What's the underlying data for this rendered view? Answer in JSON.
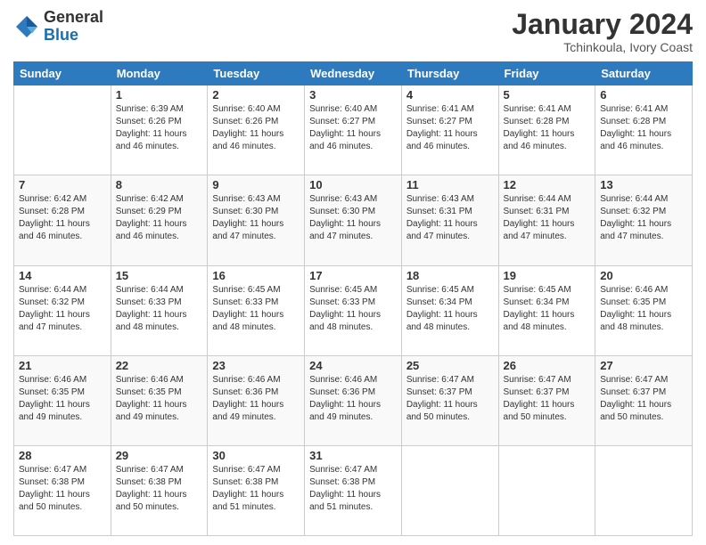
{
  "header": {
    "logo_general": "General",
    "logo_blue": "Blue",
    "month_year": "January 2024",
    "location": "Tchinkoula, Ivory Coast"
  },
  "weekdays": [
    "Sunday",
    "Monday",
    "Tuesday",
    "Wednesday",
    "Thursday",
    "Friday",
    "Saturday"
  ],
  "weeks": [
    [
      {
        "day": "",
        "info": ""
      },
      {
        "day": "1",
        "info": "Sunrise: 6:39 AM\nSunset: 6:26 PM\nDaylight: 11 hours\nand 46 minutes."
      },
      {
        "day": "2",
        "info": "Sunrise: 6:40 AM\nSunset: 6:26 PM\nDaylight: 11 hours\nand 46 minutes."
      },
      {
        "day": "3",
        "info": "Sunrise: 6:40 AM\nSunset: 6:27 PM\nDaylight: 11 hours\nand 46 minutes."
      },
      {
        "day": "4",
        "info": "Sunrise: 6:41 AM\nSunset: 6:27 PM\nDaylight: 11 hours\nand 46 minutes."
      },
      {
        "day": "5",
        "info": "Sunrise: 6:41 AM\nSunset: 6:28 PM\nDaylight: 11 hours\nand 46 minutes."
      },
      {
        "day": "6",
        "info": "Sunrise: 6:41 AM\nSunset: 6:28 PM\nDaylight: 11 hours\nand 46 minutes."
      }
    ],
    [
      {
        "day": "7",
        "info": "Sunrise: 6:42 AM\nSunset: 6:28 PM\nDaylight: 11 hours\nand 46 minutes."
      },
      {
        "day": "8",
        "info": "Sunrise: 6:42 AM\nSunset: 6:29 PM\nDaylight: 11 hours\nand 46 minutes."
      },
      {
        "day": "9",
        "info": "Sunrise: 6:43 AM\nSunset: 6:30 PM\nDaylight: 11 hours\nand 47 minutes."
      },
      {
        "day": "10",
        "info": "Sunrise: 6:43 AM\nSunset: 6:30 PM\nDaylight: 11 hours\nand 47 minutes."
      },
      {
        "day": "11",
        "info": "Sunrise: 6:43 AM\nSunset: 6:31 PM\nDaylight: 11 hours\nand 47 minutes."
      },
      {
        "day": "12",
        "info": "Sunrise: 6:44 AM\nSunset: 6:31 PM\nDaylight: 11 hours\nand 47 minutes."
      },
      {
        "day": "13",
        "info": "Sunrise: 6:44 AM\nSunset: 6:32 PM\nDaylight: 11 hours\nand 47 minutes."
      }
    ],
    [
      {
        "day": "14",
        "info": "Sunrise: 6:44 AM\nSunset: 6:32 PM\nDaylight: 11 hours\nand 47 minutes."
      },
      {
        "day": "15",
        "info": "Sunrise: 6:44 AM\nSunset: 6:33 PM\nDaylight: 11 hours\nand 48 minutes."
      },
      {
        "day": "16",
        "info": "Sunrise: 6:45 AM\nSunset: 6:33 PM\nDaylight: 11 hours\nand 48 minutes."
      },
      {
        "day": "17",
        "info": "Sunrise: 6:45 AM\nSunset: 6:33 PM\nDaylight: 11 hours\nand 48 minutes."
      },
      {
        "day": "18",
        "info": "Sunrise: 6:45 AM\nSunset: 6:34 PM\nDaylight: 11 hours\nand 48 minutes."
      },
      {
        "day": "19",
        "info": "Sunrise: 6:45 AM\nSunset: 6:34 PM\nDaylight: 11 hours\nand 48 minutes."
      },
      {
        "day": "20",
        "info": "Sunrise: 6:46 AM\nSunset: 6:35 PM\nDaylight: 11 hours\nand 48 minutes."
      }
    ],
    [
      {
        "day": "21",
        "info": "Sunrise: 6:46 AM\nSunset: 6:35 PM\nDaylight: 11 hours\nand 49 minutes."
      },
      {
        "day": "22",
        "info": "Sunrise: 6:46 AM\nSunset: 6:35 PM\nDaylight: 11 hours\nand 49 minutes."
      },
      {
        "day": "23",
        "info": "Sunrise: 6:46 AM\nSunset: 6:36 PM\nDaylight: 11 hours\nand 49 minutes."
      },
      {
        "day": "24",
        "info": "Sunrise: 6:46 AM\nSunset: 6:36 PM\nDaylight: 11 hours\nand 49 minutes."
      },
      {
        "day": "25",
        "info": "Sunrise: 6:47 AM\nSunset: 6:37 PM\nDaylight: 11 hours\nand 50 minutes."
      },
      {
        "day": "26",
        "info": "Sunrise: 6:47 AM\nSunset: 6:37 PM\nDaylight: 11 hours\nand 50 minutes."
      },
      {
        "day": "27",
        "info": "Sunrise: 6:47 AM\nSunset: 6:37 PM\nDaylight: 11 hours\nand 50 minutes."
      }
    ],
    [
      {
        "day": "28",
        "info": "Sunrise: 6:47 AM\nSunset: 6:38 PM\nDaylight: 11 hours\nand 50 minutes."
      },
      {
        "day": "29",
        "info": "Sunrise: 6:47 AM\nSunset: 6:38 PM\nDaylight: 11 hours\nand 50 minutes."
      },
      {
        "day": "30",
        "info": "Sunrise: 6:47 AM\nSunset: 6:38 PM\nDaylight: 11 hours\nand 51 minutes."
      },
      {
        "day": "31",
        "info": "Sunrise: 6:47 AM\nSunset: 6:38 PM\nDaylight: 11 hours\nand 51 minutes."
      },
      {
        "day": "",
        "info": ""
      },
      {
        "day": "",
        "info": ""
      },
      {
        "day": "",
        "info": ""
      }
    ]
  ]
}
